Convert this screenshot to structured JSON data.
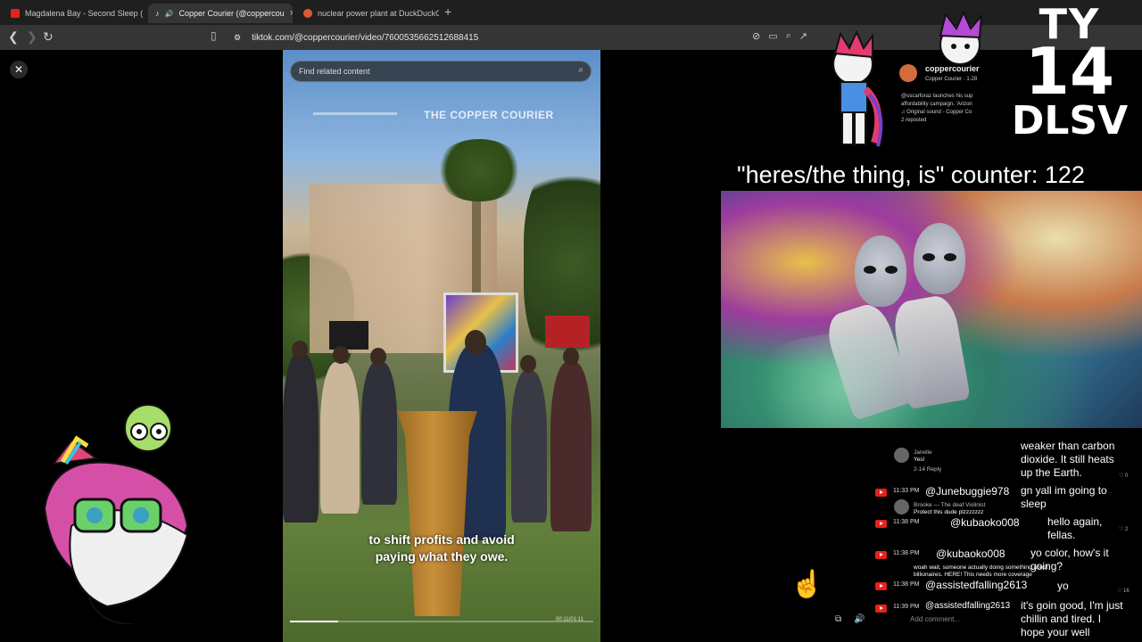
{
  "browser": {
    "tabs": [
      {
        "label": "Magdalena Bay - Second Sleep (",
        "favicon_color": "#e62117",
        "active": false
      },
      {
        "label": "Copper Courier (@coppercou",
        "favicon_color": "#ffffff",
        "active": true
      },
      {
        "label": "nuclear power plant at DuckDuckGo",
        "favicon_color": "#de5833",
        "active": false
      }
    ],
    "url": "tiktok.com/@coppercourier/video/7600535662512688415"
  },
  "video": {
    "search_placeholder": "Find related content",
    "brand": "THE COPPER COURIER",
    "caption_line1": "to shift profits and avoid",
    "caption_line2": "paying what they owe.",
    "timecode": "00:11/01:11",
    "progress": 0.16
  },
  "overlay": {
    "counter_text": "\"heres/the thing, is\" counter: 122",
    "logo_line1": "TY",
    "logo_line2": "14",
    "logo_line3": "DLSV"
  },
  "tiktok_panel": {
    "account": "coppercourier",
    "subtitle": "Copper Courier · 1-28",
    "desc1": "@oscarforaz launches his sup",
    "desc2": "affordability campaign, 'Arizon",
    "desc3": "♫ Original sound - Copper Co",
    "desc4": "2 reposted"
  },
  "chat": {
    "tt_comment_1_user": "Janelle",
    "tt_comment_1_text": "Yes!",
    "tt_comment_1_meta": "2-14 Reply",
    "tt_comment_2_user": "Brooke — The deaf Violinist",
    "tt_comment_2_text": "Protect this dude plzzzzzzz",
    "tt_comment_3_text1": "woah wait, someone actually doing something about",
    "tt_comment_3_text2": "billionaires. HERE! This needs more coverage",
    "messages": [
      {
        "time": "11:33 PM",
        "user": "@Junebuggie978",
        "text1": "gn yall im going to",
        "text2": "sleep"
      },
      {
        "time": "11:38 PM",
        "user": "@kubaoko008",
        "text1": "hello again,",
        "text2": "fellas."
      },
      {
        "time": "11:38 PM",
        "user": "@kubaoko008",
        "text1": "yo color, how's it",
        "text2": "going?"
      },
      {
        "time": "11:38 PM",
        "user": "@assistedfalling2613",
        "text1": "yo",
        "text2": ""
      },
      {
        "time": "11:39 PM",
        "user": "@assistedfalling2613",
        "text1": "it's goin good, I'm just",
        "text2": "chillin and tired. I",
        "text3": "hope your well"
      }
    ],
    "top_msg_1": "weaker than carbon",
    "top_msg_2": "dioxide. It still heats",
    "top_msg_3": "up the Earth.",
    "likes": [
      "0",
      "2",
      "16"
    ],
    "add_comment": "Add comment..."
  }
}
